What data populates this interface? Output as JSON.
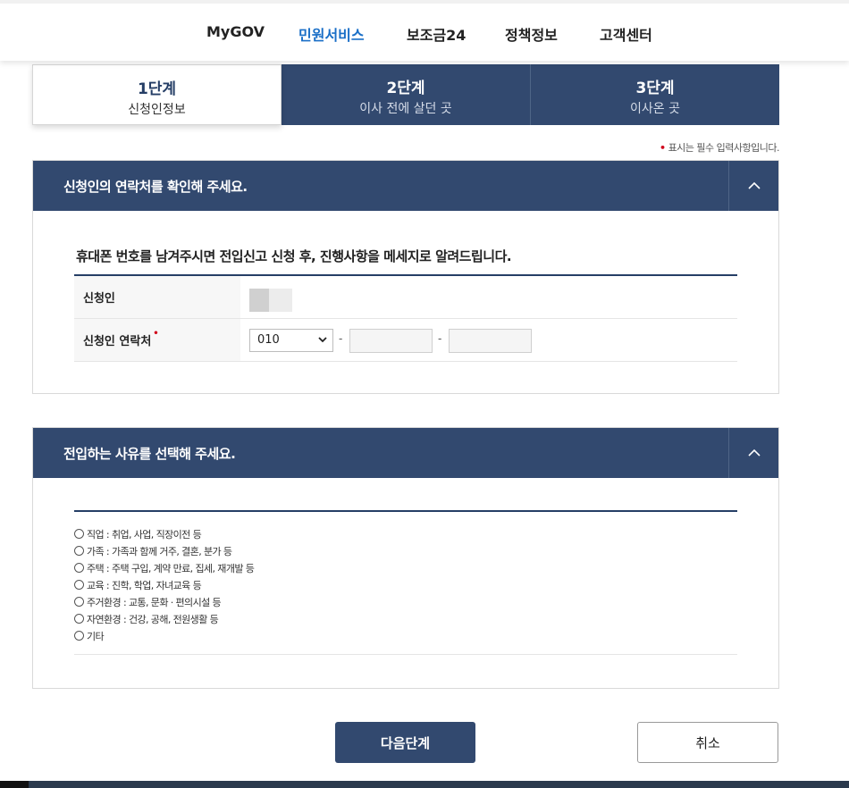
{
  "nav": {
    "items": [
      "MyGOV",
      "민원서비스",
      "보조금24",
      "정책정보",
      "고객센터"
    ],
    "active": "민원서비스"
  },
  "steps": [
    {
      "num": "1단계",
      "label": "신청인정보"
    },
    {
      "num": "2단계",
      "label": "이사 전에 살던 곳"
    },
    {
      "num": "3단계",
      "label": "이사온 곳"
    }
  ],
  "required_note": "표시는 필수 입력사항입니다.",
  "contact_section": {
    "title": "신청인의 연락처를 확인해 주세요.",
    "lead": "휴대폰 번호를 남겨주시면 전입신고 신청 후, 진행사항을 메세지로 알려드립니다.",
    "applicant_label": "신청인",
    "phone_label": "신청인 연락처",
    "phone_prefix": "010",
    "phone_mid": "",
    "phone_last": "",
    "dash": "-"
  },
  "reason_section": {
    "title": "전입하는 사유를 선택해 주세요.",
    "options": [
      "직업 : 취업, 사업, 직장이전 등",
      "가족 : 가족과 함께 거주, 결혼, 분가 등",
      "주택 : 주택 구입, 계약 만료, 집세, 재개발 등",
      "교육 : 진학, 학업, 자녀교육 등",
      "주거환경 : 교통, 문화 · 편의시설 등",
      "자연환경 : 건강, 공해, 전원생활 등",
      "기타"
    ]
  },
  "buttons": {
    "next": "다음단계",
    "cancel": "취소"
  },
  "colors": {
    "navy": "#32496f",
    "active_nav": "#1a6fc7",
    "required": "#d0021b"
  }
}
